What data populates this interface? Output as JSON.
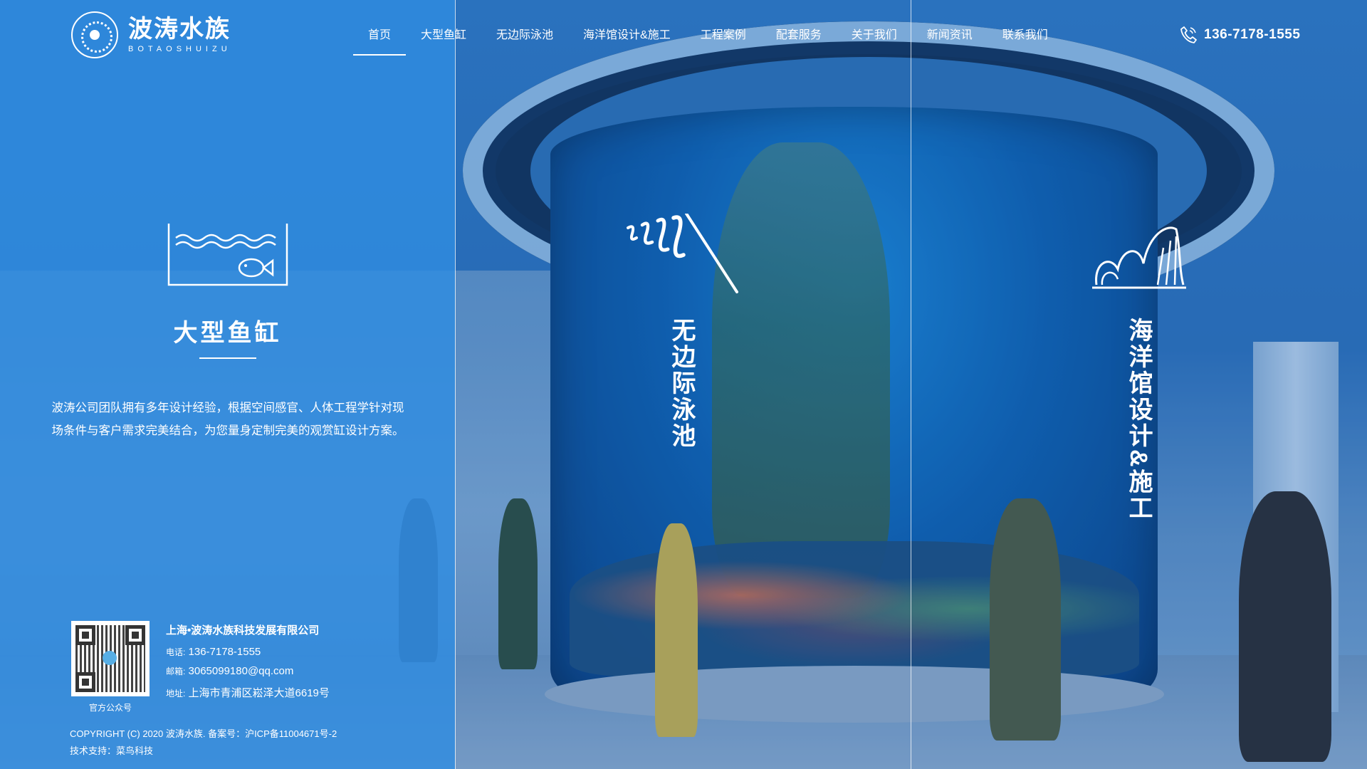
{
  "brand": {
    "name_cn": "波涛水族",
    "name_en": "BOTAOSHUIZU"
  },
  "nav": {
    "items": [
      {
        "label": "首页",
        "active": true
      },
      {
        "label": "大型鱼缸",
        "active": false
      },
      {
        "label": "无边际泳池",
        "active": false
      },
      {
        "label": "海洋馆设计&施工",
        "active": false
      },
      {
        "label": "工程案例",
        "active": false
      },
      {
        "label": "配套服务",
        "active": false
      },
      {
        "label": "关于我们",
        "active": false
      },
      {
        "label": "新闻资讯",
        "active": false
      },
      {
        "label": "联系我们",
        "active": false
      }
    ]
  },
  "header": {
    "phone": "136-7178-1555",
    "phone_icon": "phone-icon"
  },
  "panels": {
    "left": {
      "icon": "fish-tank-icon",
      "title": "大型鱼缸",
      "description": "波涛公司团队拥有多年设计经验，根据空间感官、人体工程学针对现场条件与客户需求完美结合，为您量身定制完美的观赏缸设计方案。"
    },
    "middle": {
      "icon": "waves-pool-icon",
      "title": "无边际泳池"
    },
    "right": {
      "icon": "aquarium-building-icon",
      "title": "海洋馆设计&施工"
    }
  },
  "footer": {
    "qr_label": "官方公众号",
    "company": "上海•波涛水族科技发展有限公司",
    "tel_label": "电话:",
    "tel": "136-7178-1555",
    "email_label": "邮箱:",
    "email": "3065099180@qq.com",
    "address_label": "地址:",
    "address": "上海市青浦区崧泽大道6619号",
    "copyright": "COPYRIGHT (C) 2020 波涛水族. 备案号：沪ICP备11004671号-2",
    "support": "技术支持：菜鸟科技"
  },
  "colors": {
    "left_overlay": "#308ce1",
    "accent_white": "#ffffff"
  }
}
